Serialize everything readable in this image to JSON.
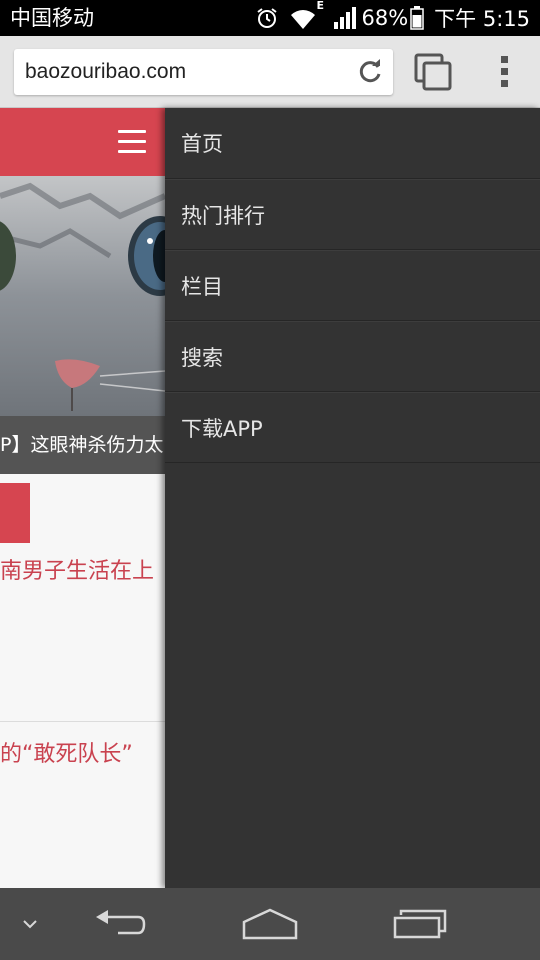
{
  "status_bar": {
    "carrier": "中国移动",
    "network_type": "E",
    "battery_percent": "68%",
    "time": "下午 5:15",
    "icons": [
      "alarm-icon",
      "wifi-icon",
      "signal-icon",
      "battery-icon"
    ]
  },
  "browser": {
    "url": "baozouribao.com",
    "icons": [
      "reload-icon",
      "tabs-icon",
      "overflow-menu-icon"
    ]
  },
  "page": {
    "header_color": "#d64550",
    "hero_caption": "P】这眼神杀伤力太",
    "articles": [
      {
        "title": "南男子生活在上"
      },
      {
        "title": "的“敢死队长”"
      }
    ]
  },
  "drawer": {
    "items": [
      {
        "label": "首页"
      },
      {
        "label": "热门排行"
      },
      {
        "label": "栏目"
      },
      {
        "label": "搜索"
      },
      {
        "label": "下载APP"
      }
    ]
  },
  "nav_bar": {
    "icons": [
      "hide-keyboard-icon",
      "back-icon",
      "home-icon",
      "recent-apps-icon"
    ]
  }
}
